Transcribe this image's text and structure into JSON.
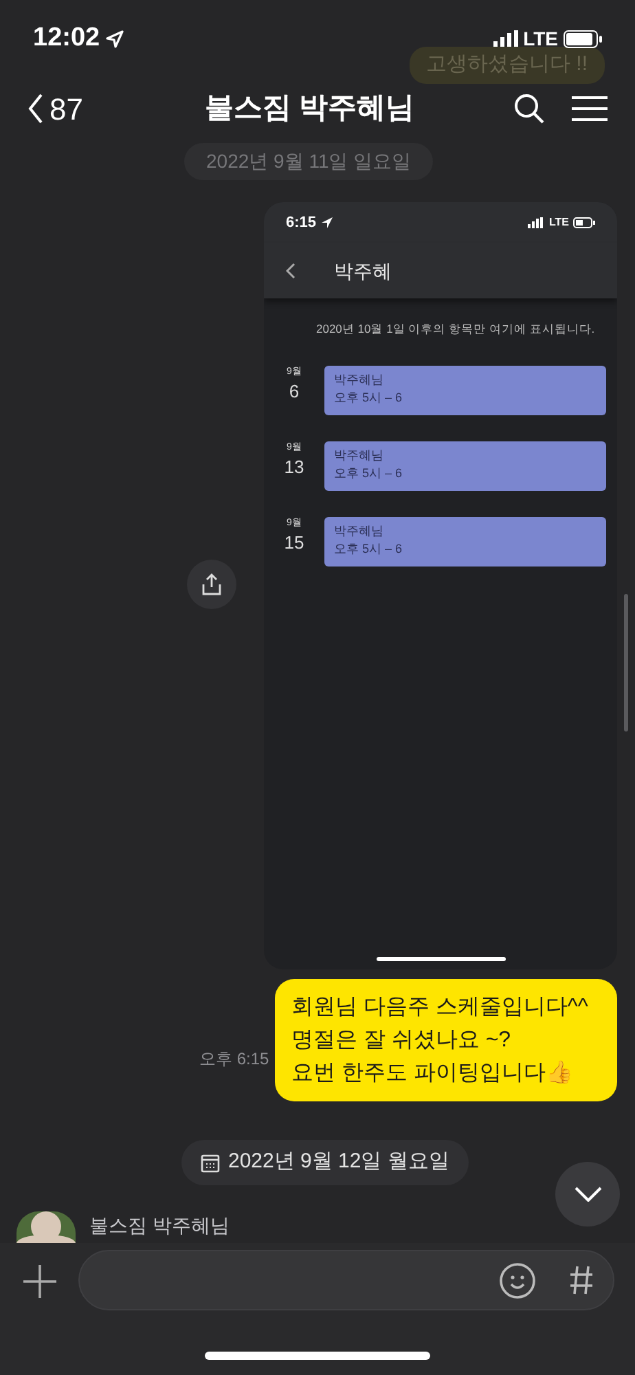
{
  "status_bar": {
    "time": "12:02",
    "network": "LTE"
  },
  "behind_header": [
    {
      "kind": "bubble",
      "text": "고생하셨습니다 !!"
    },
    {
      "kind": "date",
      "text": "2022년 9월 11일 일요일"
    }
  ],
  "header": {
    "back_count": "87",
    "title": "불스짐 박주혜님"
  },
  "shared_image": {
    "status_time": "6:15",
    "network": "LTE",
    "title": "박주혜",
    "notice": "2020년 10월 1일 이후의 항목만 여기에 표시됩니다.",
    "events": [
      {
        "month": "9월",
        "day": "6",
        "title": "박주혜님",
        "time": "오후 5시 – 6"
      },
      {
        "month": "9월",
        "day": "13",
        "title": "박주혜님",
        "time": "오후 5시 – 6"
      },
      {
        "month": "9월",
        "day": "15",
        "title": "박주혜님",
        "time": "오후 5시 – 6"
      }
    ]
  },
  "outgoing_message": {
    "lines": [
      "회원님 다음주 스케줄입니다^^",
      "명절은 잘 쉬셨나요 ~?",
      "요번 한주도 파이팅입니다👍"
    ],
    "time": "오후 6:15"
  },
  "date_divider": "2022년 9월 12일 월요일",
  "incoming": {
    "sender": "불스짐 박주혜님"
  }
}
